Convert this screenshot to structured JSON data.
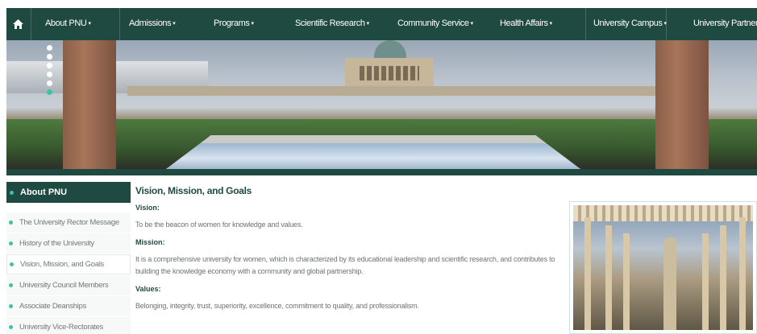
{
  "nav": {
    "home_icon": "home-icon",
    "items": [
      {
        "label": "About PNU",
        "caret": "▾"
      },
      {
        "label": "Admissions",
        "caret": "▾"
      },
      {
        "label": "Programs",
        "caret": "▾"
      },
      {
        "label": "Scientific Research",
        "caret": "▾"
      },
      {
        "label": "Community Service",
        "caret": "▾"
      },
      {
        "label": "Health Affairs",
        "caret": "▾"
      },
      {
        "label": "University Campus",
        "caret": "▾"
      },
      {
        "label": "University Partners",
        "caret": "▾"
      }
    ]
  },
  "hero": {
    "slide_count": 6,
    "active_slide": 6
  },
  "sidebar": {
    "title": "About PNU",
    "items": [
      {
        "label": "The University Rector Message"
      },
      {
        "label": "History of the University"
      },
      {
        "label": "Vision, Mission, and Goals"
      },
      {
        "label": "University Council Members"
      },
      {
        "label": "Associate Deanships"
      },
      {
        "label": "University Vice-Rectorates"
      }
    ],
    "active_index": 2
  },
  "main": {
    "title": "Vision, Mission, and Goals",
    "vision_heading": "Vision:",
    "vision_text": "To be the beacon of women for knowledge and values.",
    "mission_heading": "Mission:",
    "mission_text": "It is a comprehensive university for women, which is characterized by its educational leadership and scientific research, and contributes to building the knowledge economy with a community and global partnership.",
    "values_heading": "Values:",
    "values_text": "Belonging, integrity, trust, superiority, excellence, commitment to quality, and professionalism."
  },
  "colors": {
    "primary": "#1f4a42",
    "accent": "#3fc2a4",
    "muted_text": "#6c7573"
  }
}
